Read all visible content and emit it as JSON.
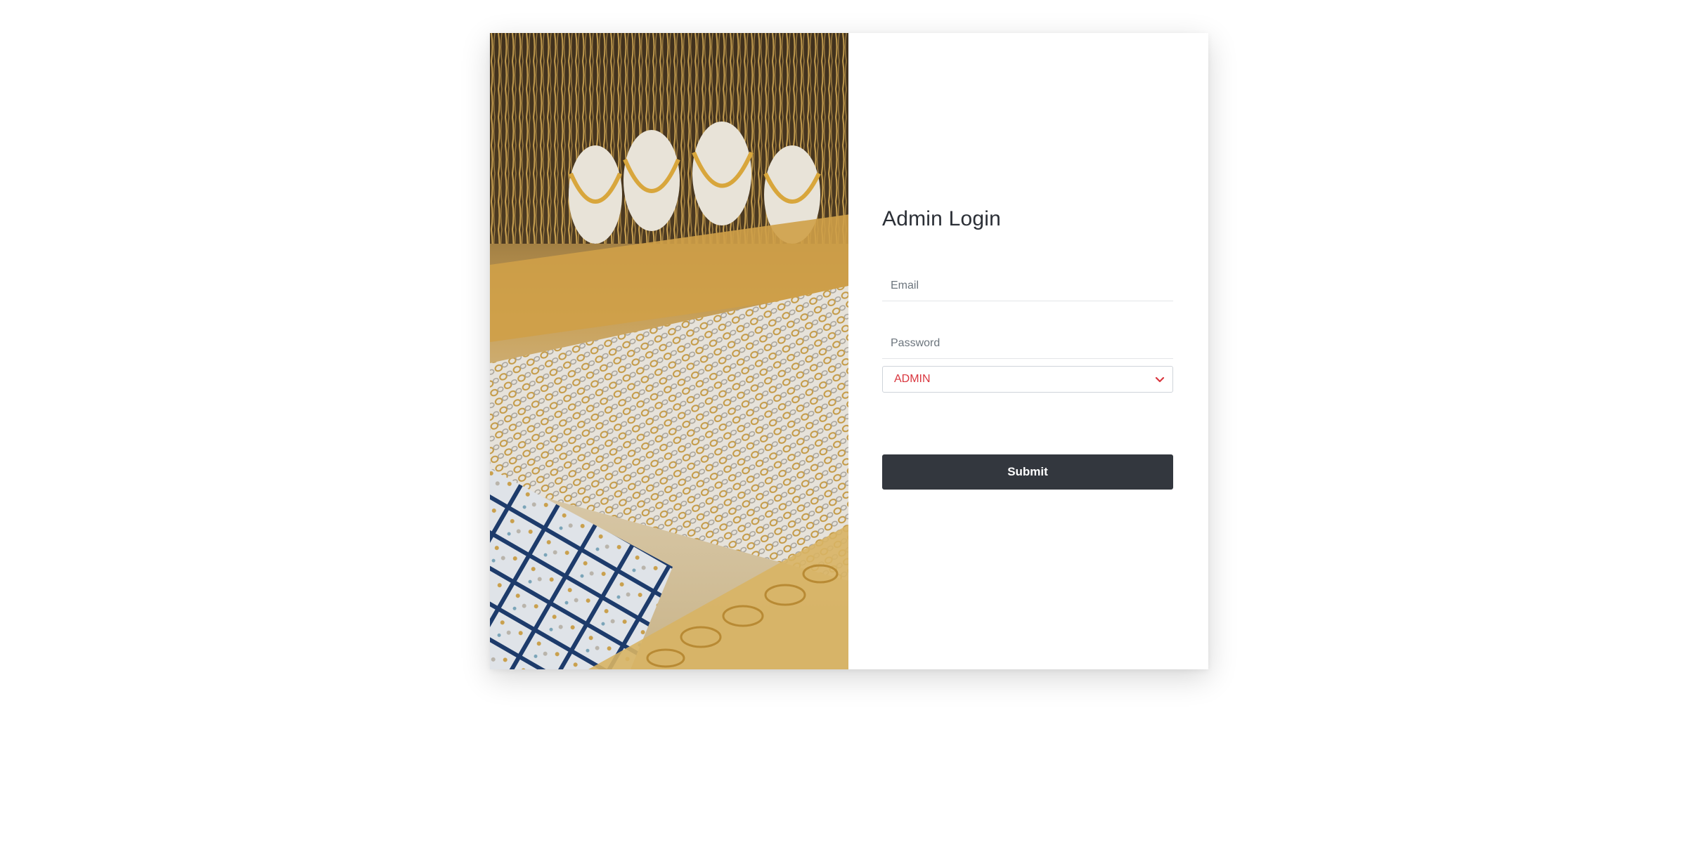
{
  "login": {
    "title": "Admin Login",
    "email_placeholder": "Email",
    "email_value": "",
    "password_placeholder": "Password",
    "password_value": "",
    "role_selected": "ADMIN",
    "submit_label": "Submit"
  },
  "colors": {
    "button_bg": "#33373e",
    "select_text": "#d9363e",
    "title_text": "#2b2f36"
  },
  "icons": {
    "select_arrow": "chevron-down-icon"
  }
}
